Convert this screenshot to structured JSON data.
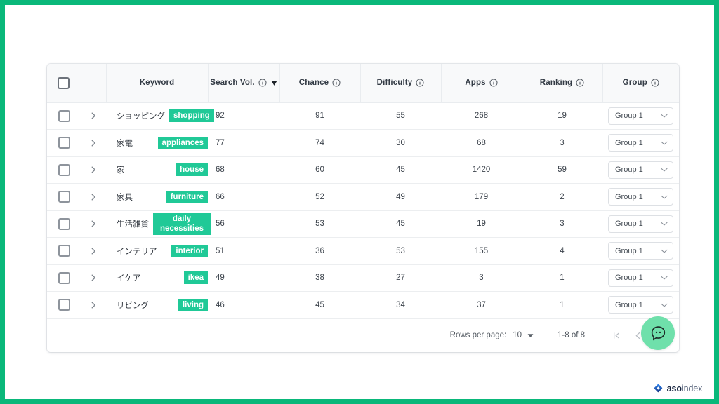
{
  "theme": {
    "frame_green": "#0ab87a",
    "tag_green": "#20c997",
    "fab_green": "#6fe0ab",
    "header_bg": "#f8f9fa",
    "brand_blue": "#1b6df0"
  },
  "table": {
    "columns": [
      {
        "id": "select",
        "label": "",
        "info": false,
        "sorted": false
      },
      {
        "id": "expand",
        "label": "",
        "info": false,
        "sorted": false
      },
      {
        "id": "keyword",
        "label": "Keyword",
        "info": false,
        "sorted": false
      },
      {
        "id": "search_vol",
        "label": "Search Vol.",
        "info": true,
        "sorted": true
      },
      {
        "id": "chance",
        "label": "Chance",
        "info": true,
        "sorted": false
      },
      {
        "id": "difficulty",
        "label": "Difficulty",
        "info": true,
        "sorted": false
      },
      {
        "id": "apps",
        "label": "Apps",
        "info": true,
        "sorted": false
      },
      {
        "id": "ranking",
        "label": "Ranking",
        "info": true,
        "sorted": false
      },
      {
        "id": "group",
        "label": "Group",
        "info": true,
        "sorted": false
      }
    ],
    "header_select_all_checked": false,
    "sort": {
      "column": "Search Vol.",
      "direction": "desc"
    },
    "rows": [
      {
        "keyword": "ショッピング",
        "tag": "shopping",
        "search_vol": "92",
        "chance": "91",
        "difficulty": "55",
        "apps": "268",
        "ranking": "19",
        "group": "Group 1",
        "checked": false
      },
      {
        "keyword": "家電",
        "tag": "appliances",
        "search_vol": "77",
        "chance": "74",
        "difficulty": "30",
        "apps": "68",
        "ranking": "3",
        "group": "Group 1",
        "checked": false
      },
      {
        "keyword": "家",
        "tag": "house",
        "search_vol": "68",
        "chance": "60",
        "difficulty": "45",
        "apps": "1420",
        "ranking": "59",
        "group": "Group 1",
        "checked": false
      },
      {
        "keyword": "家具",
        "tag": "furniture",
        "search_vol": "66",
        "chance": "52",
        "difficulty": "49",
        "apps": "179",
        "ranking": "2",
        "group": "Group 1",
        "checked": false
      },
      {
        "keyword": "生活雑貨",
        "tag": "daily necessities",
        "search_vol": "56",
        "chance": "53",
        "difficulty": "45",
        "apps": "19",
        "ranking": "3",
        "group": "Group 1",
        "checked": false
      },
      {
        "keyword": "インテリア",
        "tag": "interior",
        "search_vol": "51",
        "chance": "36",
        "difficulty": "53",
        "apps": "155",
        "ranking": "4",
        "group": "Group 1",
        "checked": false
      },
      {
        "keyword": "イケア",
        "tag": "ikea",
        "search_vol": "49",
        "chance": "38",
        "difficulty": "27",
        "apps": "3",
        "ranking": "1",
        "group": "Group 1",
        "checked": false
      },
      {
        "keyword": "リビング",
        "tag": "living",
        "search_vol": "46",
        "chance": "45",
        "difficulty": "34",
        "apps": "37",
        "ranking": "1",
        "group": "Group 1",
        "checked": false
      }
    ]
  },
  "pagination": {
    "rows_per_page_label": "Rows per page:",
    "rows_per_page_value": "10",
    "range_label": "1-8 of 8",
    "first_page_icon": "first-page-icon",
    "prev_page_icon": "chevron-left-icon",
    "next_page_icon": "chevron-right-icon"
  },
  "chat_widget": {
    "icon": "chat-bubble-icon",
    "label": ""
  },
  "brand": {
    "diamond_icon": "diamond-logo-icon",
    "name_bold": "aso",
    "name_light": "index"
  }
}
